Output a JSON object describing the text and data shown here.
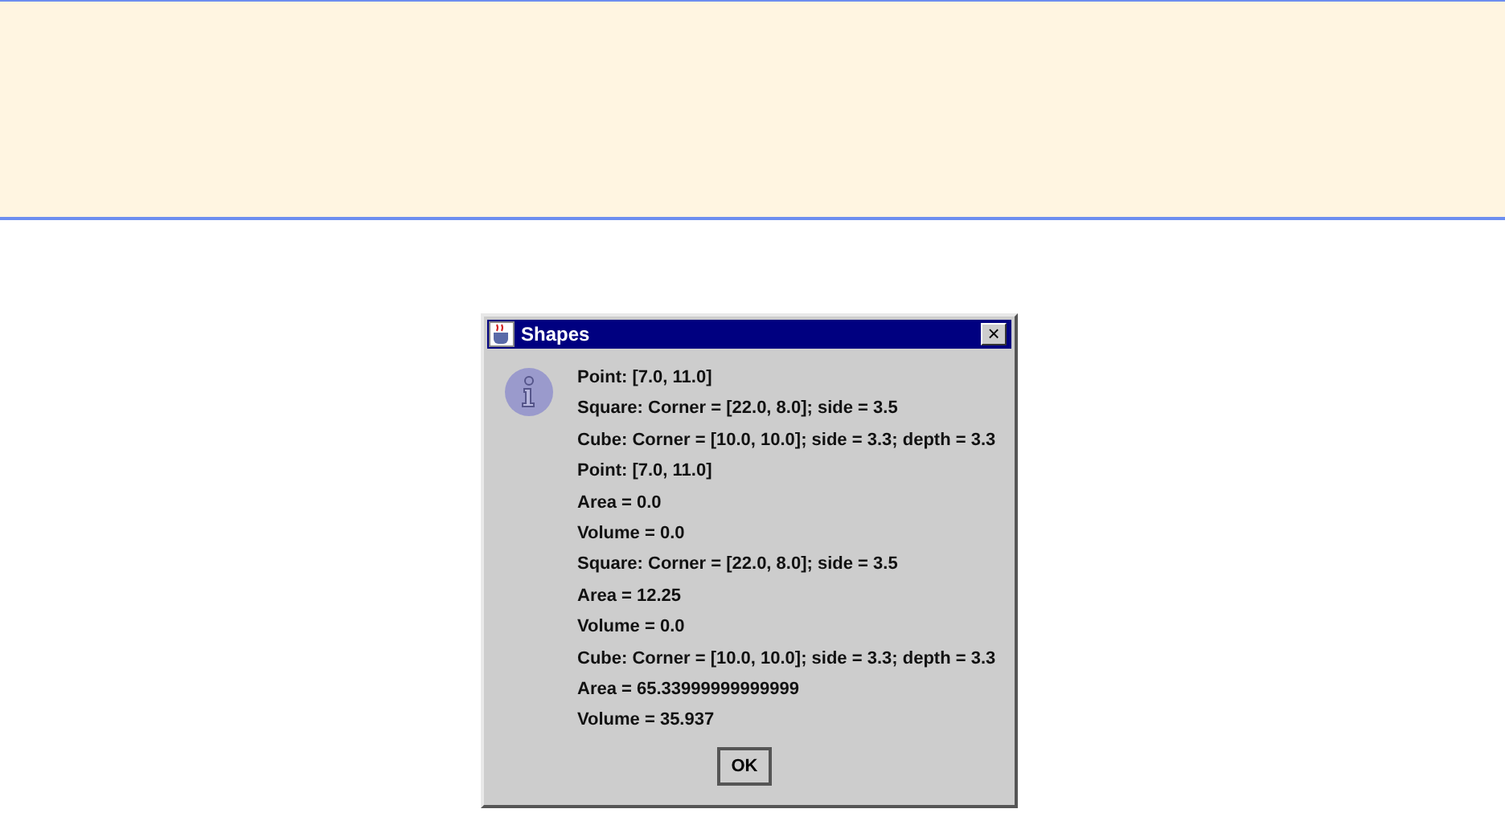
{
  "dialog": {
    "title": "Shapes",
    "close_label": "×",
    "lines": [
      "Point: [7.0, 11.0]",
      "Square: Corner = [22.0, 8.0]; side = 3.5",
      "Cube: Corner = [10.0, 10.0]; side = 3.3; depth = 3.3",
      "Point: [7.0, 11.0]",
      "Area = 0.0",
      "Volume = 0.0",
      "Square: Corner = [22.0, 8.0]; side = 3.5",
      "Area = 12.25",
      "Volume = 0.0",
      "Cube: Corner = [10.0, 10.0]; side = 3.3; depth = 3.3",
      "Area = 65.33999999999999",
      "Volume = 35.937"
    ],
    "buttons": [
      "OK"
    ]
  }
}
